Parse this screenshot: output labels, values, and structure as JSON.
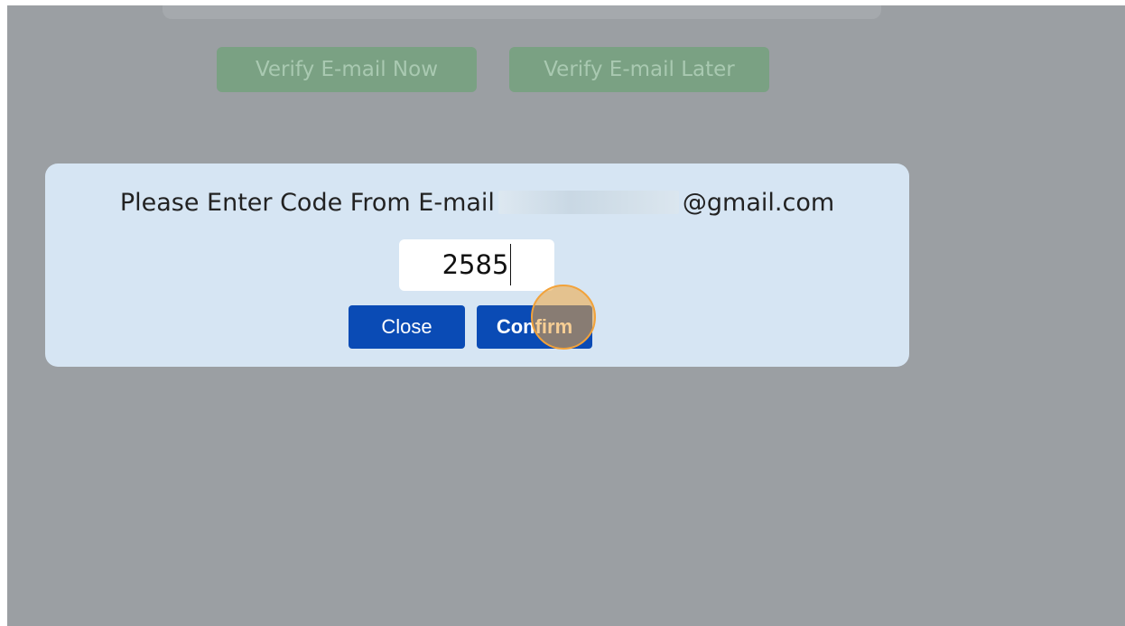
{
  "background": {
    "verify_now_label": "Verify E-mail Now",
    "verify_later_label": "Verify E-mail Later"
  },
  "dialog": {
    "prompt_prefix": "Please Enter Code From E-mail",
    "email_suffix": "@gmail.com",
    "code_value": "2585",
    "close_label": "Close",
    "confirm_label": "Confirm"
  },
  "colors": {
    "overlay": "#9b9fa3",
    "dialog_bg": "#d6e5f3",
    "button_blue": "#0a4bb5",
    "bg_button_green": "#7aa183",
    "click_marker": "#f2a23a"
  }
}
